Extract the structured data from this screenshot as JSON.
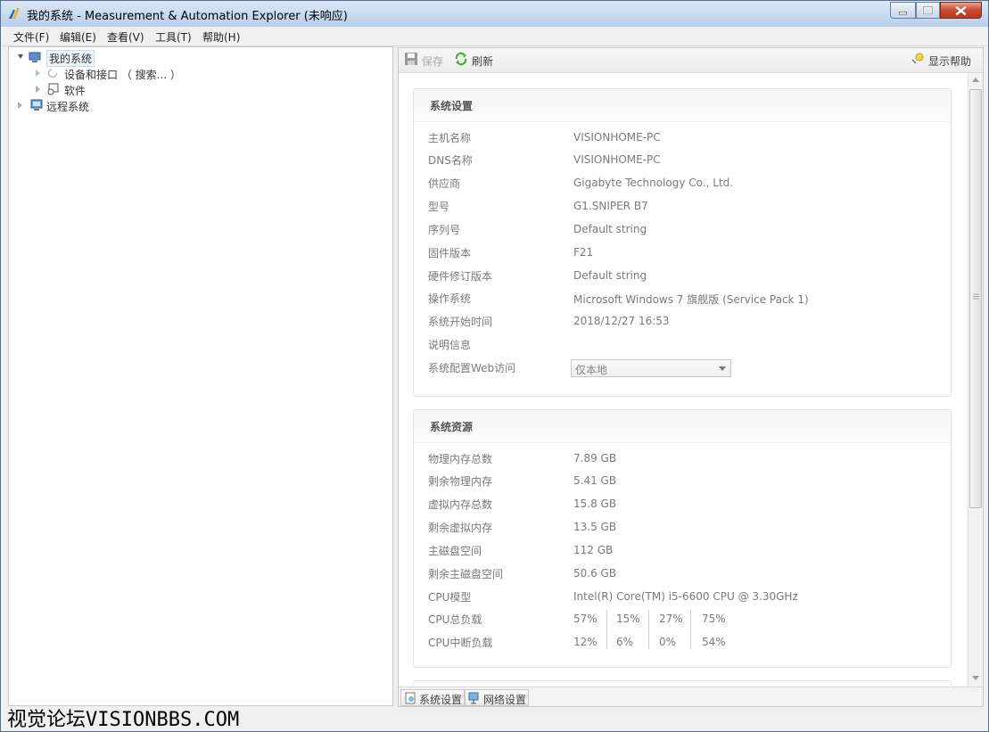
{
  "window": {
    "title": "我的系统 - Measurement & Automation Explorer (未响应)"
  },
  "menu": {
    "items": [
      "文件(F)",
      "编辑(E)",
      "查看(V)",
      "工具(T)",
      "帮助(H)"
    ]
  },
  "tree": {
    "root": "我的系统",
    "devices": "设备和接口 （ 搜索... ）",
    "software": "软件",
    "remote": "远程系统"
  },
  "toolbar": {
    "save": "保存",
    "refresh": "刷新",
    "help": "显示帮助"
  },
  "system_settings": {
    "title": "系统设置",
    "rows": [
      {
        "label": "主机名称",
        "value": "VISIONHOME-PC"
      },
      {
        "label": "DNS名称",
        "value": "VISIONHOME-PC"
      },
      {
        "label": "供应商",
        "value": "Gigabyte Technology Co., Ltd."
      },
      {
        "label": "型号",
        "value": "G1.SNIPER B7"
      },
      {
        "label": "序列号",
        "value": "Default string"
      },
      {
        "label": "固件版本",
        "value": "F21"
      },
      {
        "label": "硬件修订版本",
        "value": "Default string"
      },
      {
        "label": "操作系统",
        "value": "Microsoft Windows 7 旗舰版  (Service Pack 1)"
      },
      {
        "label": "系统开始时间",
        "value": "2018/12/27 16:53"
      },
      {
        "label": "说明信息",
        "value": ""
      }
    ],
    "web_access_label": "系统配置Web访问",
    "web_access_value": "仅本地"
  },
  "system_resources": {
    "title": "系统资源",
    "rows": [
      {
        "label": "物理内存总数",
        "value": "7.89 GB"
      },
      {
        "label": "剩余物理内存",
        "value": "5.41 GB"
      },
      {
        "label": "虚拟内存总数",
        "value": "15.8 GB"
      },
      {
        "label": "剩余虚拟内存",
        "value": "13.5 GB"
      },
      {
        "label": "主磁盘空间",
        "value": "112 GB"
      },
      {
        "label": "剩余主磁盘空间",
        "value": "50.6 GB"
      },
      {
        "label": "CPU模型",
        "value": "Intel(R) Core(TM) i5-6600 CPU @ 3.30GHz"
      }
    ],
    "cpu_load_label": "CPU总负载",
    "cpu_load": [
      "57%",
      "15%",
      "27%",
      "75%"
    ],
    "cpu_int_label": "CPU中断负载",
    "cpu_int": [
      "12%",
      "6%",
      "0%",
      "54%"
    ]
  },
  "tabs": {
    "system": "系统设置",
    "network": "网络设置"
  },
  "watermark": "视觉论坛VISIONBBS.COM"
}
